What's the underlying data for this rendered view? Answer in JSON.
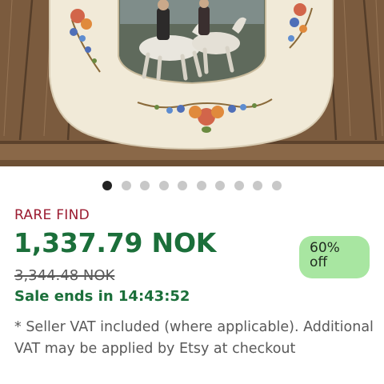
{
  "product": {
    "image_alt": "Decorative plate with horses scene",
    "gallery": {
      "total": 10,
      "active_index": 0
    }
  },
  "badge_label": "RARE FIND",
  "pricing": {
    "current_price": "1,337.79 NOK",
    "original_price": "3,344.48 NOK",
    "sale_ends": "Sale ends in 14:43:52",
    "discount_line1": "60%",
    "discount_line2": "off"
  },
  "vat_note": "* Seller VAT included (where applicable). Additional VAT may be applied by Etsy at checkout",
  "colors": {
    "rare_find": "#9b1b30",
    "price_green": "#1b6f3a",
    "discount_bg": "#a8e6a1",
    "strike_gray": "#595959"
  }
}
